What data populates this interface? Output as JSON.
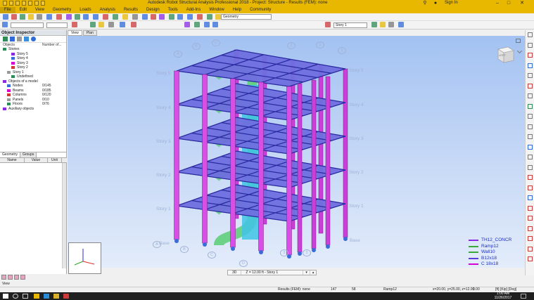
{
  "window": {
    "title": "Autodesk Robot Structural Analysis Professional 2018 - Project: Structure - Results (FEM): none",
    "sign_in": "Sign In"
  },
  "menu": [
    "File",
    "Edit",
    "View",
    "Geometry",
    "Loads",
    "Analysis",
    "Results",
    "Design",
    "Tools",
    "Add-Ins",
    "Window",
    "Help",
    "Community"
  ],
  "toolbar": {
    "layout_combo": "Geometry",
    "story_combo": "Story 1"
  },
  "object_inspector": {
    "title": "Object Inspector",
    "columns": [
      "Objects",
      "Number of..."
    ],
    "tree": [
      {
        "label": "Stories",
        "value": "",
        "indent": 0
      },
      {
        "label": "Story 5",
        "value": "",
        "indent": 2
      },
      {
        "label": "Story 4",
        "value": "",
        "indent": 2
      },
      {
        "label": "Story 3",
        "value": "",
        "indent": 2
      },
      {
        "label": "Story 2",
        "value": "",
        "indent": 2
      },
      {
        "label": "Story 1",
        "value": "",
        "indent": 1
      },
      {
        "label": "Undefined",
        "value": "",
        "indent": 2
      },
      {
        "label": "Objects of a model",
        "value": "",
        "indent": 0
      },
      {
        "label": "Nodes",
        "value": "0/145",
        "indent": 1
      },
      {
        "label": "Beams",
        "value": "0/185",
        "indent": 1
      },
      {
        "label": "Columns",
        "value": "0/120",
        "indent": 1
      },
      {
        "label": "Panels",
        "value": "0/10",
        "indent": 1
      },
      {
        "label": "Floors",
        "value": "0/76",
        "indent": 1
      },
      {
        "label": "Auxiliary objects",
        "value": "",
        "indent": 0
      }
    ],
    "tabs": [
      "Geometry",
      "Groups"
    ],
    "prop_columns": [
      "Name",
      "Value",
      "Unit"
    ]
  },
  "view_tabs": [
    "View",
    "Plan"
  ],
  "viewport": {
    "stories": [
      "Story 5",
      "Story 4",
      "Story 3",
      "Story 2",
      "Story 1",
      "Base"
    ],
    "grid_top": [
      "A",
      "B",
      "C",
      "3",
      "2",
      "1"
    ],
    "grid_bottom": [
      "A",
      "B",
      "C",
      "D",
      "3",
      "2"
    ],
    "cube_label": "LEFT",
    "legend": [
      {
        "label": "TH12_CONCR",
        "color": "#8a2be2"
      },
      {
        "label": "Ramp12",
        "color": "#3aa83a"
      },
      {
        "label": "Wall10",
        "color": "#3aa83a"
      },
      {
        "label": "B12x18",
        "color": "#5a3ed6"
      },
      {
        "label": "C 18x18",
        "color": "#d400d4"
      }
    ]
  },
  "viewport_status": {
    "mode": "3D",
    "z": "Z = 12.00 ft - Story 1"
  },
  "status": {
    "left": "View"
  },
  "infobar": {
    "results": "Results (FEM): none",
    "count1": "147",
    "count2": "58",
    "section": "Ramp12",
    "coords": "x=20.00, y=25.00, z=12.00",
    "units": "0.00",
    "dims": "[ft] [Kip] [Deg]"
  },
  "taskbar": {
    "time": "1:00 AM",
    "date": "11/26/2017"
  }
}
